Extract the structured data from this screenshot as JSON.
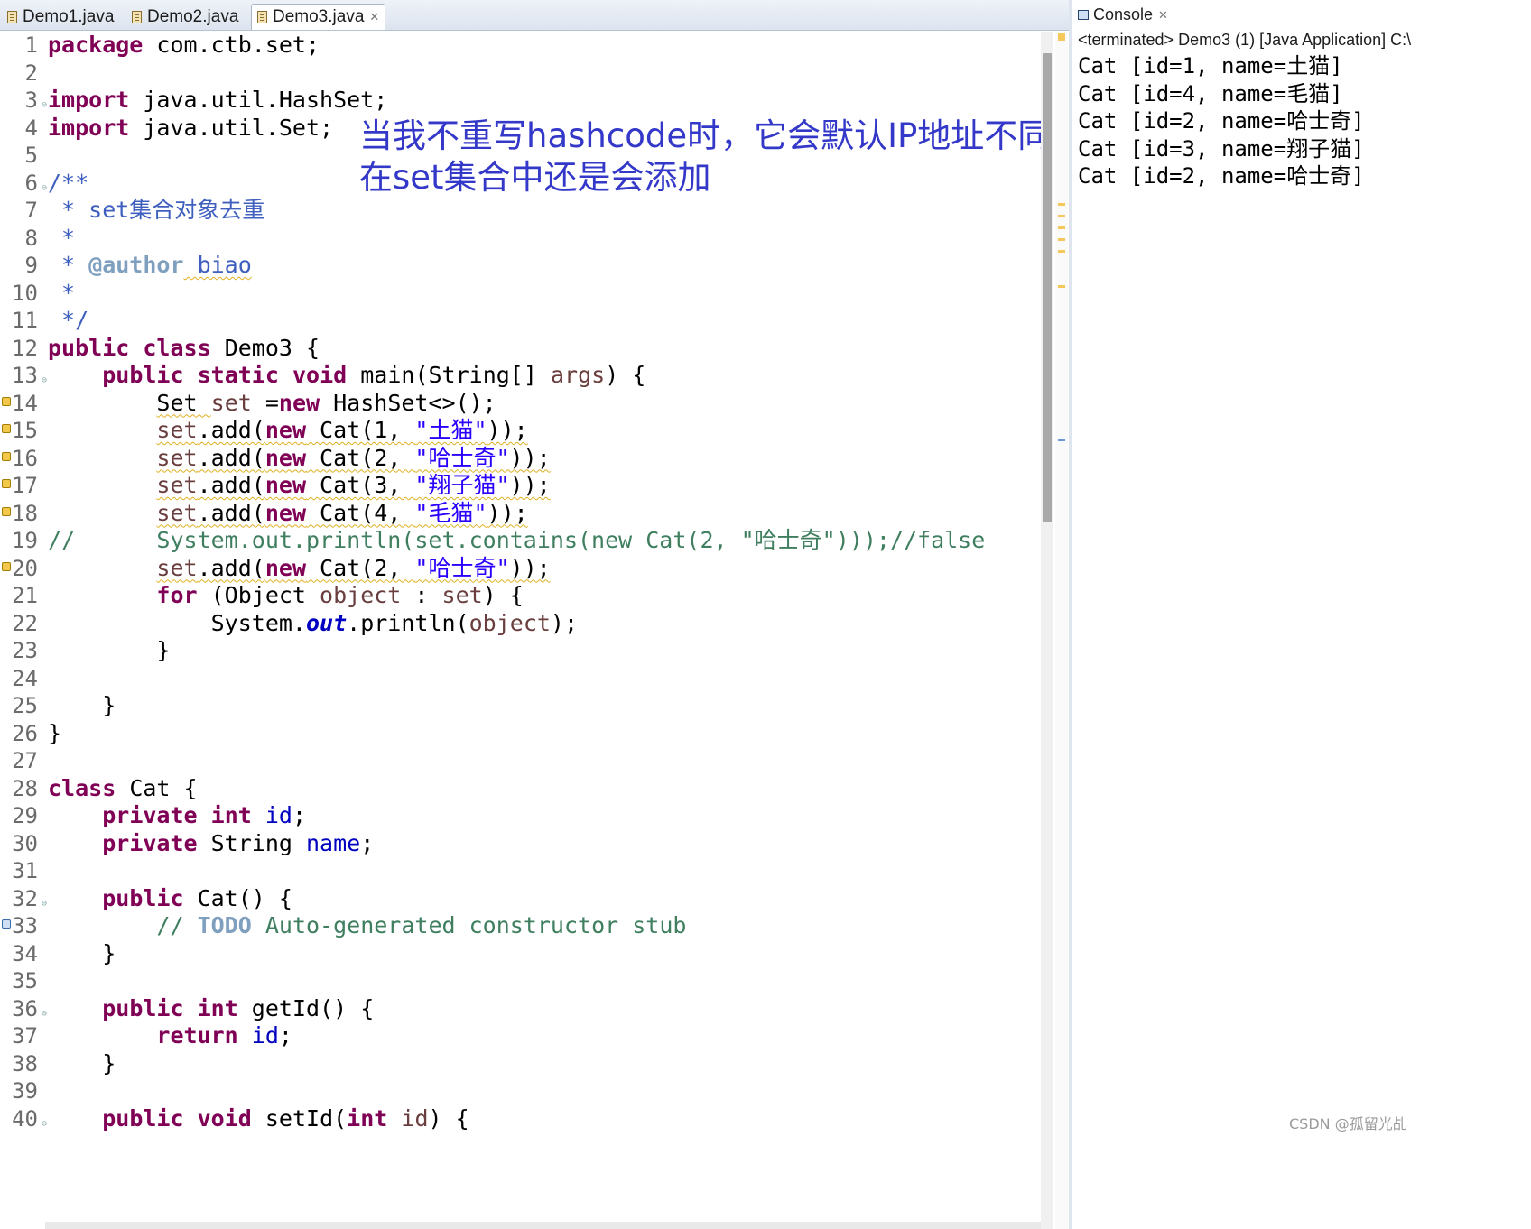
{
  "editor": {
    "tabs": [
      {
        "label": "Demo1.java",
        "active": false
      },
      {
        "label": "Demo2.java",
        "active": false
      },
      {
        "label": "Demo3.java",
        "active": true,
        "close": "✕"
      }
    ],
    "annotation": {
      "line1": "当我不重写hashcode时，它会默认IP地址不同",
      "line2": "在set集合中还是会添加"
    },
    "line_numbers": [
      "1",
      "2",
      "3",
      "4",
      "5",
      "6",
      "7",
      "8",
      "9",
      "10",
      "11",
      "12",
      "13",
      "14",
      "15",
      "16",
      "17",
      "18",
      "19",
      "20",
      "21",
      "22",
      "23",
      "24",
      "25",
      "26",
      "27",
      "28",
      "29",
      "30",
      "31",
      "32",
      "33",
      "34",
      "35",
      "36",
      "37",
      "38",
      "39",
      "40"
    ],
    "code": {
      "l1": {
        "k": "package",
        "t": " com.ctb.set;"
      },
      "l3": {
        "k": "import",
        "t": " java.util.HashSet;"
      },
      "l4": {
        "k": "import",
        "t": " java.util.Set;"
      },
      "l6": "/**",
      "l7": " * set集合对象去重",
      "l8": " *",
      "l9": {
        "a": " * ",
        "tag": "@author",
        "t": " biao"
      },
      "l10": " *",
      "l11": " */",
      "l12": {
        "k1": "public",
        "k2": "class",
        "t": " Demo3 {"
      },
      "l13": {
        "ind": "    ",
        "k1": "public",
        "k2": "static",
        "k3": "void",
        "t1": " main(String[] ",
        "v": "args",
        "t2": ") {"
      },
      "l14": {
        "ind": "        ",
        "a": "Set ",
        "v": "set",
        "b": " =",
        "k": "new",
        "c": " HashSet<>();"
      },
      "l15": {
        "v": "set",
        "a": ".add(",
        "k": "new",
        "b": " Cat(1, ",
        "s": "\"土猫\"",
        "c": "));"
      },
      "l16": {
        "v": "set",
        "a": ".add(",
        "k": "new",
        "b": " Cat(2, ",
        "s": "\"哈士奇\"",
        "c": "));"
      },
      "l17": {
        "v": "set",
        "a": ".add(",
        "k": "new",
        "b": " Cat(3, ",
        "s": "\"翔子猫\"",
        "c": "));"
      },
      "l18": {
        "v": "set",
        "a": ".add(",
        "k": "new",
        "b": " Cat(4, ",
        "s": "\"毛猫\"",
        "c": "));"
      },
      "l19": "//      System.out.println(set.contains(new Cat(2, \"哈士奇\")));//false",
      "l20": {
        "v": "set",
        "a": ".add(",
        "k": "new",
        "b": " Cat(2, ",
        "s": "\"哈士奇\"",
        "c": "));"
      },
      "l21": {
        "k": "for",
        "a": " (Object ",
        "v1": "object",
        "b": " : ",
        "v2": "set",
        "c": ") {"
      },
      "l22": {
        "a": "System.",
        "st": "out",
        "b": ".println(",
        "v": "object",
        "c": ");"
      },
      "l23": "        }",
      "l25": "    }",
      "l26": "}",
      "l28": {
        "k": "class",
        "t": " Cat {"
      },
      "l29": {
        "k1": "private",
        "k2": "int",
        "f": "id",
        "t": ";"
      },
      "l30": {
        "k1": "private",
        "a": " String ",
        "f": "name",
        "t": ";"
      },
      "l32": {
        "k": "public",
        "t": " Cat() {"
      },
      "l33": {
        "c": "// ",
        "todo": "TODO",
        "t": " Auto-generated constructor stub"
      },
      "l34": "    }",
      "l36": {
        "k1": "public",
        "k2": "int",
        "t": " getId() {"
      },
      "l37": {
        "k": "return",
        "f": "id",
        "t": ";"
      },
      "l38": "    }",
      "l40": {
        "k1": "public",
        "k2": "void",
        "a": " setId(",
        "k3": "int",
        "v": "id",
        "t": ") {"
      }
    }
  },
  "console": {
    "tab_label": "Console",
    "close": "✕",
    "status": "<terminated> Demo3 (1) [Java Application] C:\\",
    "output": [
      "Cat [id=1, name=土猫]",
      "Cat [id=4, name=毛猫]",
      "Cat [id=2, name=哈士奇]",
      "Cat [id=3, name=翔子猫]",
      "Cat [id=2, name=哈士奇]"
    ]
  },
  "watermark": "CSDN @孤留光乩"
}
